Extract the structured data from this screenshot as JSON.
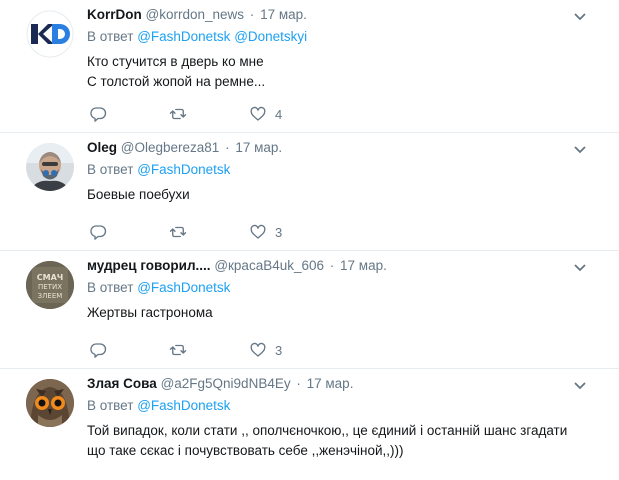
{
  "tweets": [
    {
      "name": "KorrDon",
      "handle": "@korrdon_news",
      "dot": "·",
      "time": "17 мар.",
      "reply_prefix": "В ответ",
      "mentions": [
        "@FashDonetsk",
        "@Donetskyi"
      ],
      "lines": [
        "Кто стучится в дверь ко мне",
        "С толстой жопой на ремне..."
      ],
      "likes": "4",
      "avatar": "korrdon-logo"
    },
    {
      "name": "Oleg",
      "handle": "@Olegbereza81",
      "dot": "·",
      "time": "17 мар.",
      "reply_prefix": "В ответ",
      "mentions": [
        "@FashDonetsk"
      ],
      "lines": [
        "Боевые поебухи"
      ],
      "likes": "3",
      "avatar": "man-with-respirator"
    },
    {
      "name": "мудрец говорил....",
      "handle": "@красаB4uk_606",
      "dot": "·",
      "time": "17 мар.",
      "reply_prefix": "В ответ",
      "mentions": [
        "@FashDonetsk"
      ],
      "lines": [
        "Жертвы гастронома"
      ],
      "likes": "3",
      "avatar": "wall-graffiti",
      "avatar_text": [
        "СМАЧ",
        "ПЕТИХ",
        "ЗЛЕЕМ"
      ]
    },
    {
      "name": "Злая Сова",
      "handle": "@a2Fg5Qni9dNB4Ey",
      "dot": "·",
      "time": "17 мар.",
      "reply_prefix": "В ответ",
      "mentions": [
        "@FashDonetsk"
      ],
      "lines": [
        "Той випадок, коли стати ,, ополчєночкою,, це єдиний і останній шанс згадати",
        "що таке сєкас і почувствовать себе ,,женэчіной,,)))"
      ],
      "likes": "",
      "avatar": "owl"
    }
  ],
  "colors": {
    "link": "#1da1f2",
    "muted": "#657786",
    "divider": "#e6ecf0"
  },
  "icons": {
    "reply": "reply-icon",
    "retweet": "retweet-icon",
    "like": "heart-icon",
    "menu": "chevron-down-icon"
  }
}
